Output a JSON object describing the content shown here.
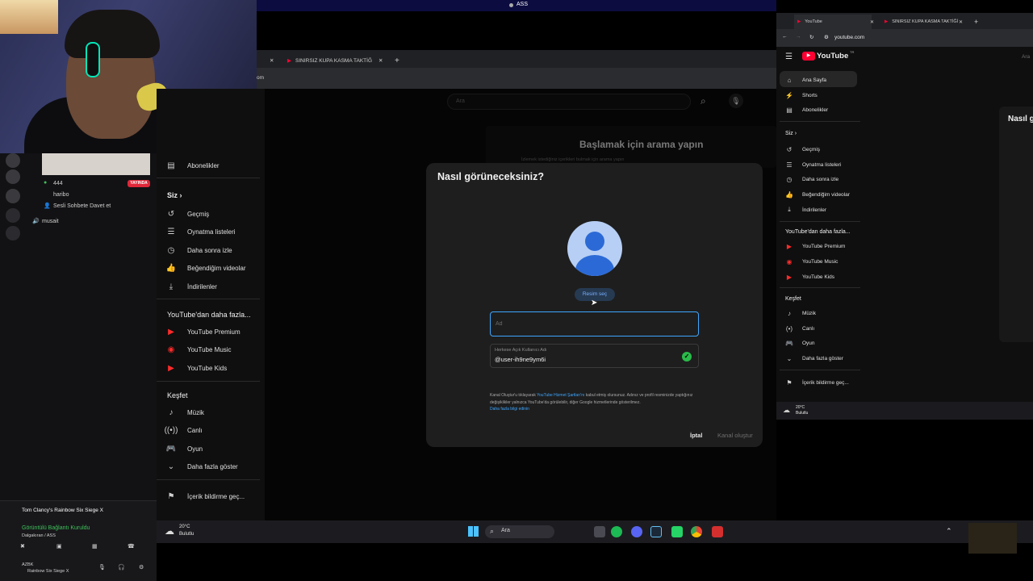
{
  "top_bar": {
    "title": "ASS"
  },
  "discord": {
    "user_count": "444",
    "live_badge": "YAYINDA",
    "channel_user": "haribo",
    "invite": "Sesli Sohbete Davet et",
    "voice_channel": "musait",
    "game_activity": "Tom Clancy's Rainbow Six Siege X",
    "connection_status": "Görüntülü Bağlantı Kuruldu",
    "connection_location": "Dalgakıran / ASS",
    "username": "AZBK",
    "user_status": "Rainbow Six Siege X"
  },
  "main_browser": {
    "tab_title": "SINIRSIZ KUPA KASMA TAKTİĞ",
    "url_fragment": "om",
    "search_placeholder": "Ara",
    "start_title": "Başlamak için arama yapın",
    "start_sub": "İzlemek istediğiniz içerikleri bulmak için arama yapın",
    "sidebar": {
      "subscriptions": "Abonelikler",
      "you_header": "Siz",
      "items": [
        "Geçmiş",
        "Oynatma listeleri",
        "Daha sonra izle",
        "Beğendiğim videolar",
        "İndirilenler"
      ],
      "more_header": "YouTube'dan daha fazla...",
      "more_items": [
        "YouTube Premium",
        "YouTube Music",
        "YouTube Kids"
      ],
      "explore_header": "Keşfet",
      "explore_items": [
        "Müzik",
        "Canlı",
        "Oyun",
        "Daha fazla göster"
      ],
      "report": "İçerik bildirme geç..."
    }
  },
  "dialog": {
    "title": "Nasıl görüneceksiniz?",
    "pick_picture": "Resim seç",
    "name_placeholder": "Ad",
    "handle_label": "Herkese Açık Kullanıcı Adı",
    "handle_value": "@user-ih9ne9ym6i",
    "terms_text": "Kanal Oluştur'u tıklayarak",
    "terms_link": "YouTube Hizmet Şartları'nı",
    "terms_rest": "kabul etmiş olursunuz. Adınız ve profil resminizde yaptığınız değişiklikler yalnızca YouTube'da görülebilir, diğer Google hizmetlerinde gösterilmez.",
    "learn_more": "Daha fazla bilgi edinin",
    "cancel": "İptal",
    "create": "Kanal oluştur"
  },
  "right_browser": {
    "tab_active": "YouTube",
    "tab_other": "SINIRSIZ KUPA KASMA TAKTİĞİ",
    "url": "youtube.com",
    "logo": "YouTube",
    "logo_sup": "TR",
    "nav": [
      "Ana Sayfa",
      "Shorts",
      "Abonelikler"
    ],
    "you_header": "Siz",
    "you_items": [
      "Geçmiş",
      "Oynatma listeleri",
      "Daha sonra izle",
      "Beğendiğim videolar",
      "İndirilenler"
    ],
    "more_header": "YouTube'dan daha fazla...",
    "more_items": [
      "YouTube Premium",
      "YouTube Music",
      "YouTube Kids"
    ],
    "explore_header": "Keşfet",
    "explore_items": [
      "Müzik",
      "Canlı",
      "Oyun",
      "Daha fazla göster"
    ],
    "report": "İçerik bildirme geç...",
    "card_title": "Nasıl gö",
    "search_stub": "Ara",
    "weather_temp": "20°C",
    "weather_desc": "Bulutlu"
  },
  "taskbar": {
    "weather_temp": "20°C",
    "weather_desc": "Bulutlu",
    "search": "Ara"
  },
  "colors": {
    "accent_blue": "#3ea6ff",
    "youtube_red": "#ff0033",
    "live_red": "#e0283a",
    "check_green": "#2aba4a"
  },
  "icons": [
    "windows-icon",
    "search-icon",
    "mic-icon",
    "account-avatar-icon",
    "check-icon",
    "cloud-icon",
    "home-icon"
  ]
}
